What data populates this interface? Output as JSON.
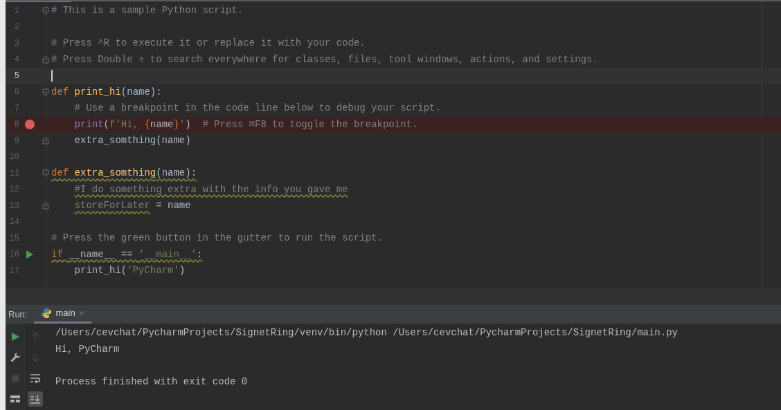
{
  "editor": {
    "lines": [
      {
        "number": "1",
        "fold_start": true,
        "tokens": [
          {
            "kind": "comment",
            "text": "# This is a sample Python script."
          }
        ]
      },
      {
        "number": "2"
      },
      {
        "number": "3",
        "tokens": [
          {
            "kind": "comment",
            "text": "# Press ^R to execute it or replace it with your code."
          }
        ]
      },
      {
        "number": "4",
        "fold_end": true,
        "tokens": [
          {
            "kind": "comment",
            "text": "# Press Double ⇮ to search everywhere for classes, files, tool windows, actions, and settings."
          }
        ]
      },
      {
        "number": "5",
        "current": true
      },
      {
        "number": "6",
        "fold_start": true,
        "tokens": [
          {
            "kind": "keyword",
            "text": "def "
          },
          {
            "kind": "function",
            "text": "print_hi"
          },
          {
            "kind": "plain",
            "text": "(name):"
          }
        ]
      },
      {
        "number": "7",
        "indented": true,
        "tokens": [
          {
            "kind": "comment",
            "text": "# Use a breakpoint in the code line below to debug your script."
          }
        ]
      },
      {
        "number": "8",
        "indented": true,
        "breakpoint": true,
        "tokens": [
          {
            "kind": "builtin",
            "text": "print"
          },
          {
            "kind": "plain",
            "text": "("
          },
          {
            "kind": "string",
            "text": "f'Hi, "
          },
          {
            "kind": "brace",
            "text": "{"
          },
          {
            "kind": "plain",
            "text": "name"
          },
          {
            "kind": "brace",
            "text": "}"
          },
          {
            "kind": "string",
            "text": "'"
          },
          {
            "kind": "plain",
            "text": ")  "
          },
          {
            "kind": "comment",
            "text": "# Press ⌘F8 to toggle the breakpoint."
          }
        ]
      },
      {
        "number": "9",
        "indented": true,
        "fold_end": true,
        "tokens": [
          {
            "kind": "plain",
            "text": "extra_somthing(name)"
          }
        ]
      },
      {
        "number": "10"
      },
      {
        "number": "11",
        "fold_start": true,
        "tokens": [
          {
            "kind": "keyword",
            "text": "def ",
            "wavy": true
          },
          {
            "kind": "function",
            "text": "extra_somthing",
            "wavy": true
          },
          {
            "kind": "plain",
            "text": "(name):",
            "wavy": true
          }
        ]
      },
      {
        "number": "12",
        "indented": true,
        "tokens": [
          {
            "kind": "comment",
            "text": "#I do something extra with the info you gave me",
            "wavy": true
          }
        ]
      },
      {
        "number": "13",
        "indented": true,
        "fold_end": true,
        "tokens": [
          {
            "kind": "comment",
            "text": "storeForLater",
            "wavy": true
          },
          {
            "kind": "plain",
            "text": " = name"
          }
        ]
      },
      {
        "number": "14"
      },
      {
        "number": "15",
        "tokens": [
          {
            "kind": "comment",
            "text": "# Press the green button in the gutter to run the script."
          }
        ]
      },
      {
        "number": "16",
        "run_marker": true,
        "tokens": [
          {
            "kind": "keyword",
            "text": "if ",
            "wavy": true
          },
          {
            "kind": "plain",
            "text": "__name__ == ",
            "wavy": true
          },
          {
            "kind": "string",
            "text": "'__main__'",
            "wavy": true
          },
          {
            "kind": "plain",
            "text": ":",
            "wavy": true
          }
        ]
      },
      {
        "number": "17",
        "indented": true,
        "tokens": [
          {
            "kind": "plain",
            "text": "print_hi("
          },
          {
            "kind": "string",
            "text": "'PyCharm'"
          },
          {
            "kind": "plain",
            "text": ")"
          }
        ]
      }
    ]
  },
  "run_panel": {
    "label": "Run:",
    "tabs": [
      {
        "label": "main",
        "close": "×",
        "selected": true
      }
    ],
    "tools_left": [
      {
        "kind": "run",
        "disabled": false
      },
      {
        "kind": "wrench",
        "disabled": false
      },
      {
        "kind": "stop",
        "disabled": true
      },
      {
        "kind": "layout",
        "disabled": false
      }
    ],
    "tools_right": [
      {
        "kind": "up",
        "disabled": true,
        "selected": false
      },
      {
        "kind": "down",
        "disabled": true,
        "selected": false
      },
      {
        "kind": "wrap",
        "disabled": false,
        "selected": false
      },
      {
        "kind": "scroll-end",
        "disabled": false,
        "selected": true
      }
    ],
    "output": [
      {
        "text": "/Users/cevchat/PycharmProjects/SignetRing/venv/bin/python /Users/cevchat/PycharmProjects/SignetRing/main.py",
        "gap_before": false
      },
      {
        "text": "Hi, PyCharm",
        "gap_before": false
      },
      {
        "text": "Process finished with exit code 0",
        "gap_before": true
      }
    ]
  }
}
